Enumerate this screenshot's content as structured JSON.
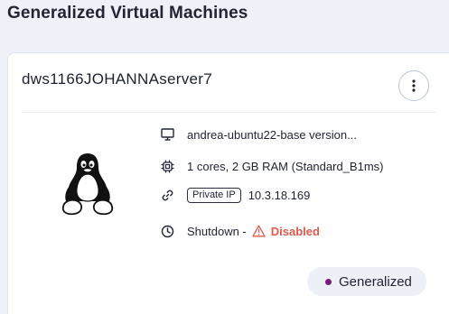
{
  "section_title": "Generalized Virtual Machines",
  "vm": {
    "name": "dws1166JOHANNAserver7",
    "os_icon": "linux-tux-icon",
    "image": "andrea-ubuntu22-base version...",
    "specs": "1 cores, 2 GB RAM (Standard_B1ms)",
    "ip_label": "Private IP",
    "ip": "10.3.18.169",
    "shutdown_label": "Shutdown -",
    "shutdown_status": "Disabled",
    "status": "Generalized"
  },
  "colors": {
    "disabled": "#e25a4b",
    "status_dot": "#7a1b7a",
    "pill_bg": "#eef0f8"
  },
  "icons": [
    "monitor-icon",
    "cpu-icon",
    "link-icon",
    "clock-icon",
    "warning-icon",
    "kebab-menu-icon"
  ]
}
